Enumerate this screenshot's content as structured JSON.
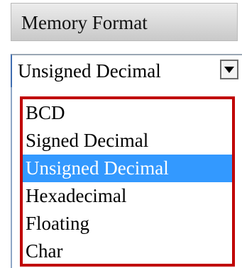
{
  "header": {
    "title": "Memory Format"
  },
  "select": {
    "value": "Unsigned Decimal",
    "options": [
      "BCD",
      "Signed Decimal",
      "Unsigned Decimal",
      "Hexadecimal",
      "Floating",
      "Char"
    ],
    "selected_index": 2
  },
  "colors": {
    "highlight": "#3399ff",
    "list_border": "#c00000",
    "header_bg": "#d9d9d9"
  }
}
